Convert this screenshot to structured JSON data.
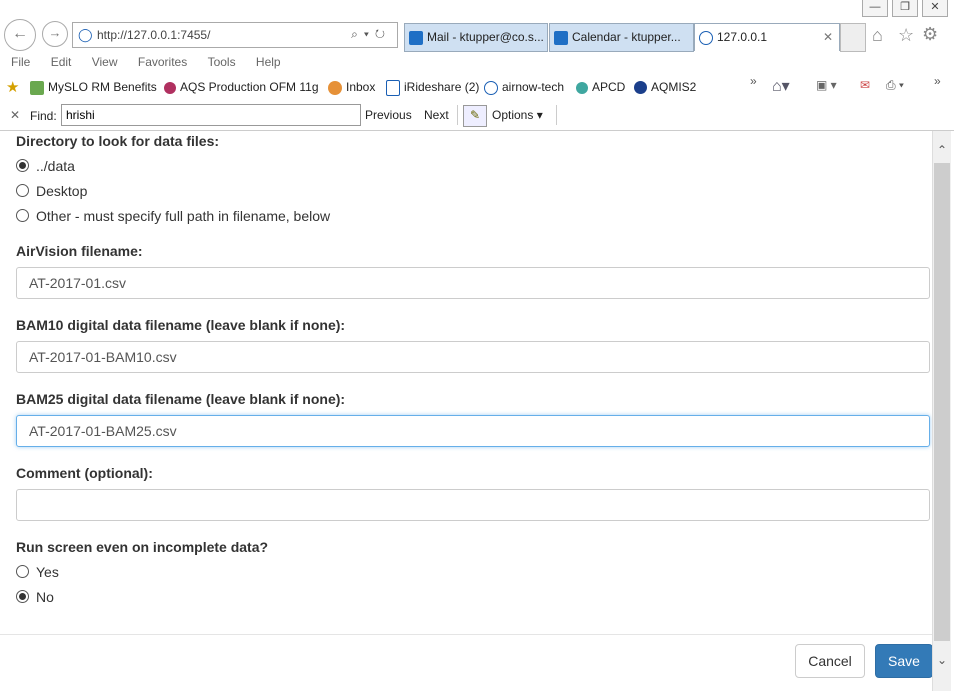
{
  "browser": {
    "address": "http://127.0.0.1:7455/",
    "tabs": [
      "Mail - ktupper@co.s...",
      "Calendar - ktupper...",
      "127.0.0.1"
    ],
    "menu": [
      "File",
      "Edit",
      "View",
      "Favorites",
      "Tools",
      "Help"
    ],
    "favorites": [
      "MySLO RM Benefits",
      "AQS Production OFM 11g",
      "Inbox",
      "iRideshare (2)",
      "airnow-tech",
      "APCD",
      "AQMIS2"
    ],
    "find": {
      "label": "Find:",
      "value": "hrishi",
      "previous": "Previous",
      "next": "Next",
      "options": "Options"
    }
  },
  "form": {
    "dir_label": "Directory to look for data files:",
    "dir_options": [
      "../data",
      "Desktop",
      "Other - must specify full path in filename, below"
    ],
    "dir_selected": 0,
    "airvision_label": "AirVision filename:",
    "airvision_value": "AT-2017-01.csv",
    "bam10_label": "BAM10 digital data filename (leave blank if none):",
    "bam10_value": "AT-2017-01-BAM10.csv",
    "bam25_label": "BAM25 digital data filename (leave blank if none):",
    "bam25_value": "AT-2017-01-BAM25.csv",
    "comment_label": "Comment (optional):",
    "comment_value": "",
    "incomplete_label": "Run screen even on incomplete data?",
    "incomplete_options": [
      "Yes",
      "No"
    ],
    "incomplete_selected": 1
  },
  "footer": {
    "cancel": "Cancel",
    "save": "Save"
  },
  "colors": {
    "save_bg": "#337ab7",
    "focus_border": "#66afe9"
  }
}
